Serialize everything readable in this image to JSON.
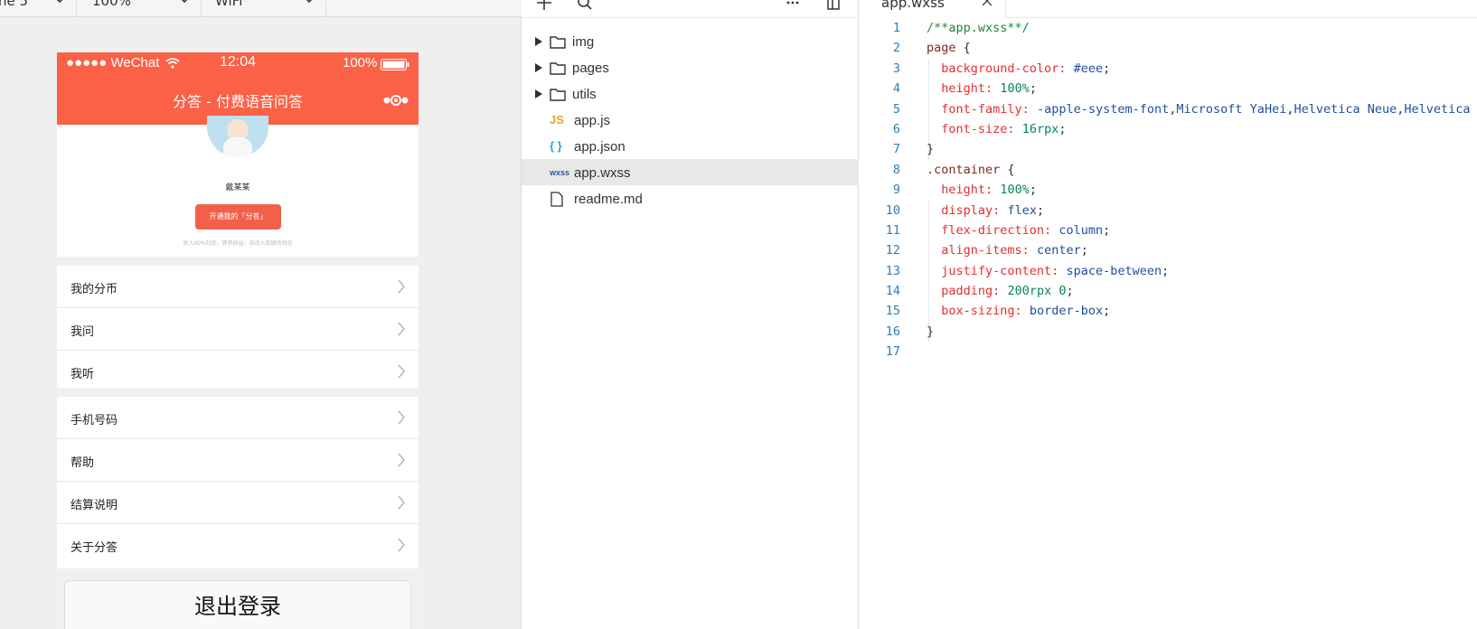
{
  "simulator": {
    "device_dropdown": "ne 5",
    "zoom_dropdown": "100%",
    "network_dropdown": "WiFi",
    "status_bar": {
      "carrier": "●●●●● WeChat",
      "time": "12:04",
      "battery_text": "100%"
    },
    "nav_title": "分答 - 付费语音问答",
    "profile": {
      "name": "戴某某",
      "open_button": "开通我的「分答」",
      "tip": "收入90%归你，即将收益，自动入库微信钱包"
    },
    "menu_group_1": [
      {
        "label": "我的分币"
      },
      {
        "label": "我问"
      },
      {
        "label": "我听"
      }
    ],
    "menu_group_2": [
      {
        "label": "手机号码"
      },
      {
        "label": "帮助"
      },
      {
        "label": "结算说明"
      },
      {
        "label": "关于分答"
      }
    ],
    "logout": "退出登录",
    "colors": {
      "accent": "#fb6147"
    }
  },
  "file_tree": {
    "items": [
      {
        "label": "img",
        "type": "folder"
      },
      {
        "label": "pages",
        "type": "folder"
      },
      {
        "label": "utils",
        "type": "folder"
      },
      {
        "label": "app.js",
        "type": "js",
        "glyph": "JS"
      },
      {
        "label": "app.json",
        "type": "json",
        "glyph": "{ }"
      },
      {
        "label": "app.wxss",
        "type": "wxss",
        "glyph": "wxss",
        "selected": true
      },
      {
        "label": "readme.md",
        "type": "md"
      }
    ]
  },
  "editor": {
    "tab": "app.wxss",
    "lines": [
      "/**app.wxss**/",
      "page {",
      "  background-color: #eee;",
      "  height: 100%;",
      "  font-family: -apple-system-font,Microsoft YaHei,Helvetica Neue,Helvetica",
      "  font-size: 16rpx;",
      "}",
      ".container {",
      "  height: 100%;",
      "  display: flex;",
      "  flex-direction: column;",
      "  align-items: center;",
      "  justify-content: space-between;",
      "  padding: 200rpx 0;",
      "  box-sizing: border-box;",
      "}",
      ""
    ]
  }
}
